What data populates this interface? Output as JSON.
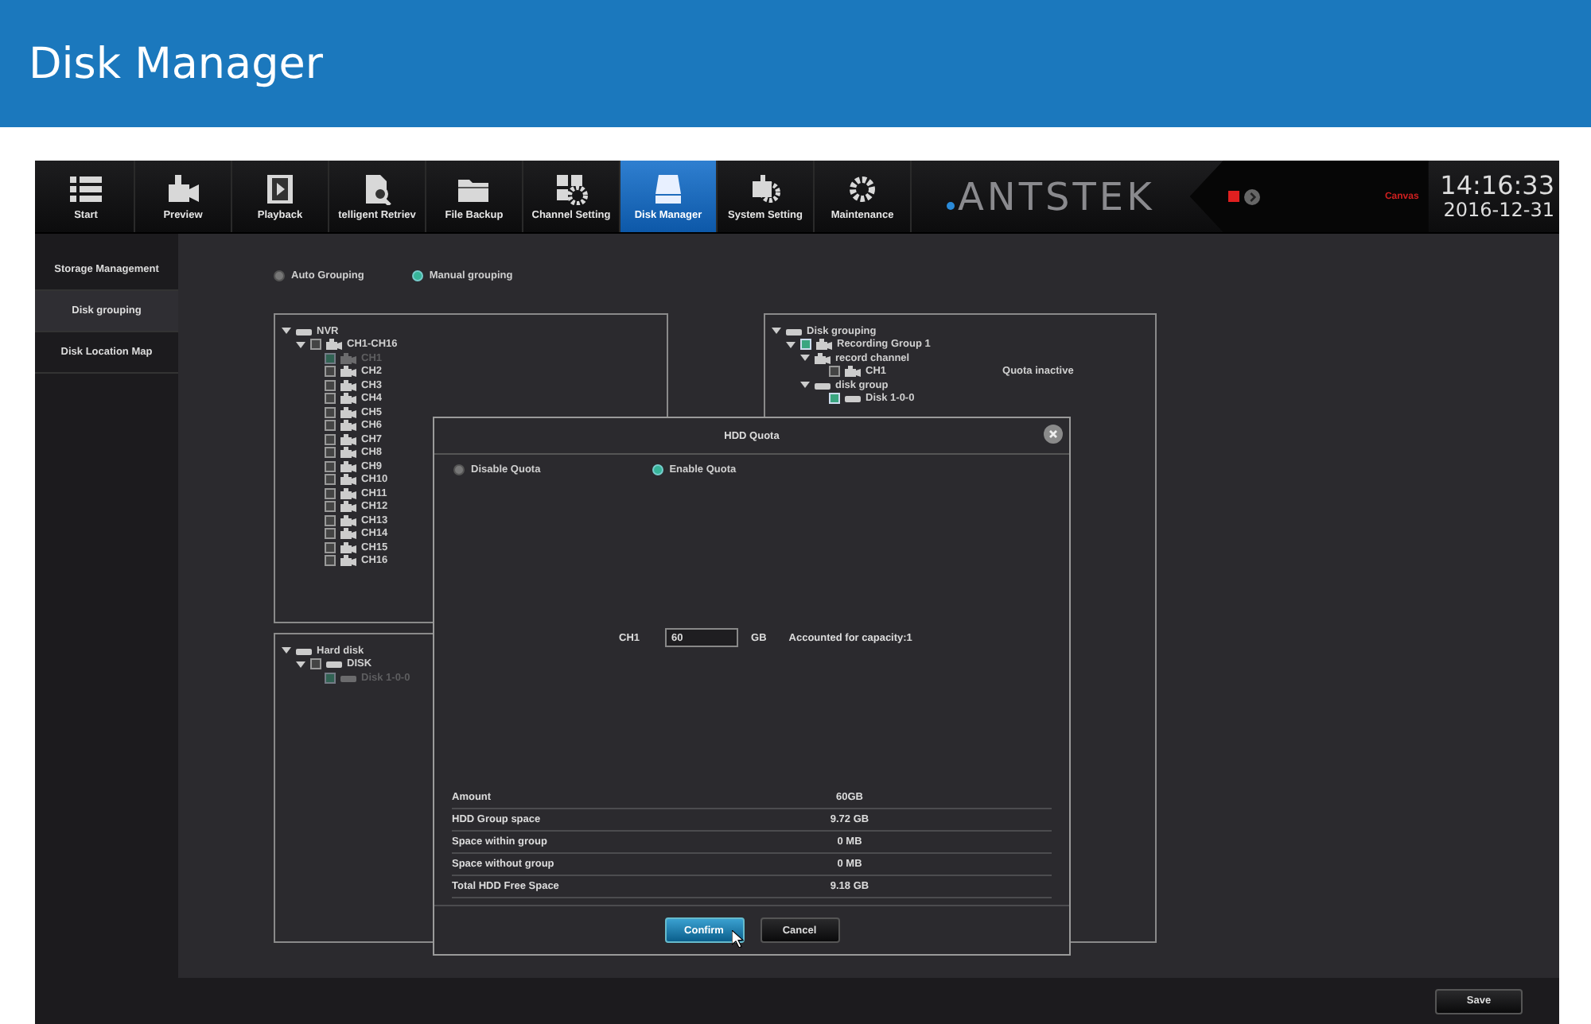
{
  "header": {
    "title": "Disk Manager"
  },
  "toolbar": {
    "tabs": [
      {
        "label": "Start",
        "selected": false
      },
      {
        "label": "Preview",
        "selected": false
      },
      {
        "label": "Playback",
        "selected": false
      },
      {
        "label": "telligent Retriev",
        "selected": false
      },
      {
        "label": "File Backup",
        "selected": false
      },
      {
        "label": "Channel Setting",
        "selected": false
      },
      {
        "label": "Disk Manager",
        "selected": true
      },
      {
        "label": "System Setting",
        "selected": false
      },
      {
        "label": "Maintenance",
        "selected": false
      }
    ],
    "logo": "ANTSTEK",
    "status_message": "Canvas",
    "time": "14:16:33",
    "date": "2016-12-31"
  },
  "sidebar": {
    "items": [
      {
        "label": "Storage Management",
        "selected": false
      },
      {
        "label": "Disk grouping",
        "selected": true
      },
      {
        "label": "Disk Location Map",
        "selected": false
      }
    ]
  },
  "grouping_mode": [
    {
      "label": "Auto Grouping",
      "selected": false
    },
    {
      "label": "Manual grouping",
      "selected": true
    }
  ],
  "channel_tree": [
    {
      "label": "NVR",
      "kind": "drive",
      "expanded": true,
      "children": [
        {
          "label": "CH1-CH16",
          "kind": "camera",
          "expanded": true,
          "checked": false,
          "children": [
            {
              "label": "CH1",
              "kind": "camera",
              "checked": true,
              "disabled": true
            },
            {
              "label": "CH2",
              "kind": "camera",
              "checked": false,
              "disabled": false
            },
            {
              "label": "CH3",
              "kind": "camera",
              "checked": false,
              "disabled": false
            },
            {
              "label": "CH4",
              "kind": "camera",
              "checked": false,
              "disabled": false
            },
            {
              "label": "CH5",
              "kind": "camera",
              "checked": false,
              "disabled": false
            },
            {
              "label": "CH6",
              "kind": "camera",
              "checked": false,
              "disabled": false
            },
            {
              "label": "CH7",
              "kind": "camera",
              "checked": false,
              "disabled": false
            },
            {
              "label": "CH8",
              "kind": "camera",
              "checked": false,
              "disabled": false
            },
            {
              "label": "CH9",
              "kind": "camera",
              "checked": false,
              "disabled": false
            },
            {
              "label": "CH10",
              "kind": "camera",
              "checked": false,
              "disabled": false
            },
            {
              "label": "CH11",
              "kind": "camera",
              "checked": false,
              "disabled": false
            },
            {
              "label": "CH12",
              "kind": "camera",
              "checked": false,
              "disabled": false
            },
            {
              "label": "CH13",
              "kind": "camera",
              "checked": false,
              "disabled": false
            },
            {
              "label": "CH14",
              "kind": "camera",
              "checked": false,
              "disabled": false
            },
            {
              "label": "CH15",
              "kind": "camera",
              "checked": false,
              "disabled": false
            },
            {
              "label": "CH16",
              "kind": "camera",
              "checked": false,
              "disabled": false
            }
          ]
        }
      ]
    }
  ],
  "disk_tree": [
    {
      "label": "Hard disk",
      "kind": "drive",
      "expanded": true,
      "children": [
        {
          "label": "DISK",
          "kind": "drive",
          "expanded": true,
          "checked": false,
          "children": [
            {
              "label": "Disk 1-0-0",
              "kind": "drive",
              "checked": true,
              "disabled": true
            }
          ]
        }
      ]
    }
  ],
  "group_tree": [
    {
      "label": "Disk grouping",
      "kind": "drive",
      "expanded": true,
      "children": [
        {
          "label": "Recording Group 1",
          "kind": "camera",
          "expanded": true,
          "checked": true,
          "children": [
            {
              "label": "record channel",
              "kind": "camera",
              "expanded": true,
              "children": [
                {
                  "label": "CH1",
                  "kind": "camera",
                  "checked": false,
                  "disabled": false,
                  "note": "Quota inactive"
                }
              ]
            },
            {
              "label": "disk group",
              "kind": "drive",
              "expanded": true,
              "children": [
                {
                  "label": "Disk 1-0-0",
                  "kind": "drive",
                  "checked": true,
                  "disabled": false
                }
              ]
            }
          ]
        }
      ]
    }
  ],
  "dialog": {
    "title": "HDD Quota",
    "quota_mode": [
      {
        "label": "Disable Quota",
        "selected": false
      },
      {
        "label": "Enable Quota",
        "selected": true
      }
    ],
    "quota": {
      "label": "CH1",
      "value": "60",
      "unit": "GB",
      "note": "Accounted for capacity:1"
    },
    "stats": [
      {
        "label": "Amount",
        "value": "60GB"
      },
      {
        "label": "HDD Group space",
        "value": "9.72 GB"
      },
      {
        "label": "Space within group",
        "value": "0 MB"
      },
      {
        "label": "Space without group",
        "value": "0 MB"
      },
      {
        "label": "Total HDD Free Space",
        "value": "9.18 GB"
      }
    ],
    "buttons": [
      {
        "label": "Confirm",
        "kind": "primary"
      },
      {
        "label": "Cancel",
        "kind": "secondary"
      }
    ]
  },
  "footer": {
    "save_button": "Save"
  }
}
